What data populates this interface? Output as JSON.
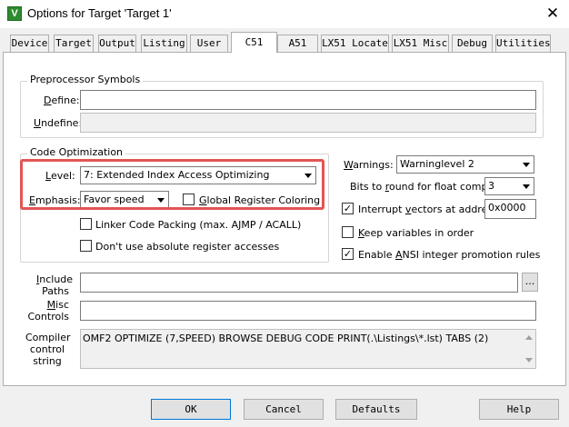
{
  "window": {
    "title": "Options for Target 'Target 1'",
    "app_icon_glyph": "V",
    "close_glyph": "✕"
  },
  "tabs": [
    {
      "label": "Device"
    },
    {
      "label": "Target"
    },
    {
      "label": "Output"
    },
    {
      "label": "Listing"
    },
    {
      "label": "User"
    },
    {
      "label": "C51"
    },
    {
      "label": "A51"
    },
    {
      "label": "LX51 Locate"
    },
    {
      "label": "LX51 Misc"
    },
    {
      "label": "Debug"
    },
    {
      "label": "Utilities"
    }
  ],
  "active_tab": "C51",
  "preprocessor": {
    "group_label": "Preprocessor Symbols",
    "define_label_u": "D",
    "define_label_rest": "efine:",
    "define_value": "",
    "undefine_label_u": "U",
    "undefine_label_rest": "ndefine:",
    "undefine_value": ""
  },
  "code_optimization": {
    "group_label": "Code Optimization",
    "level_label_u": "L",
    "level_label_rest": "evel:",
    "level_value": "7: Extended Index Access Optimizing",
    "emphasis_label_u": "E",
    "emphasis_label_rest": "mphasis:",
    "emphasis_value": "Favor speed",
    "global_register_coloring": {
      "label_u": "G",
      "label_rest": "lobal Register Coloring",
      "checked": false
    },
    "linker_code_packing": {
      "label": "Linker Code Packing (max. AJMP / ACALL)",
      "checked": false
    },
    "no_absolute_register": {
      "label": "Don't use absolute register accesses",
      "checked": false
    }
  },
  "right_options": {
    "warnings_label_u": "W",
    "warnings_label_rest": "arnings:",
    "warnings_value": "Warninglevel 2",
    "bits_label_pre": "Bits to ",
    "bits_label_u": "r",
    "bits_label_rest": "ound for float compare:",
    "bits_value": "3",
    "interrupt_vectors": {
      "label_pre": "Interrupt ",
      "label_u": "v",
      "label_rest": "ectors at address:",
      "checked": true,
      "value": "0x0000"
    },
    "keep_variables": {
      "label_u": "K",
      "label_rest": "eep variables in order",
      "checked": false
    },
    "ansi_promotion": {
      "label_pre": "Enable ",
      "label_u": "A",
      "label_rest": "NSI integer promotion rules",
      "checked": true
    }
  },
  "include_paths": {
    "label_u": "I",
    "label_rest": "nclude",
    "label_line2": "Paths",
    "value": "",
    "browse_label": "..."
  },
  "misc_controls": {
    "label_u": "M",
    "label_rest": "isc",
    "label_line2": "Controls",
    "value": ""
  },
  "compiler_control": {
    "label_line1": "Compiler",
    "label_line2": "control",
    "label_line3": "string",
    "value": "OMF2 OPTIMIZE (7,SPEED) BROWSE DEBUG CODE PRINT(.\\Listings\\*.lst) TABS (2)"
  },
  "buttons": {
    "ok": "OK",
    "cancel": "Cancel",
    "defaults": "Defaults",
    "help": "Help"
  },
  "colors": {
    "highlight": "#e25555",
    "dialog_bg": "#f0f0f0",
    "default_button_border": "#0078d7"
  }
}
